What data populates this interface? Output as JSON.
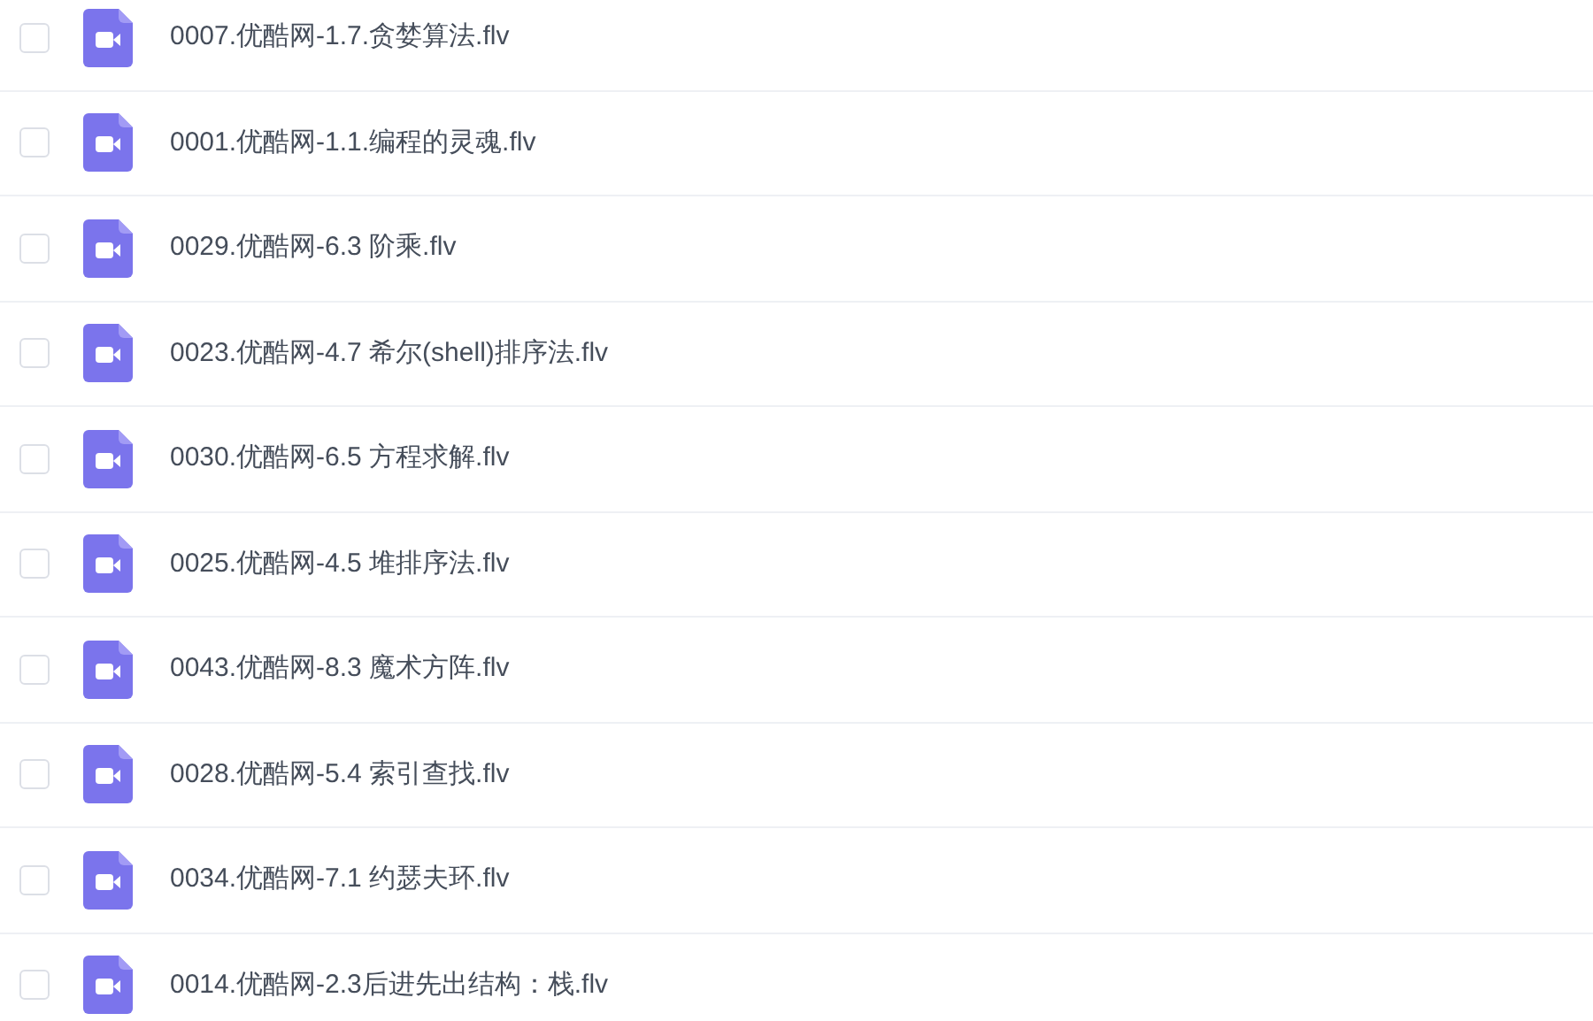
{
  "files": [
    {
      "name": "0007.优酷网-1.7.贪婪算法.flv",
      "checked": false
    },
    {
      "name": "0001.优酷网-1.1.编程的灵魂.flv",
      "checked": false
    },
    {
      "name": "0029.优酷网-6.3 阶乘.flv",
      "checked": false
    },
    {
      "name": "0023.优酷网-4.7 希尔(shell)排序法.flv",
      "checked": false
    },
    {
      "name": "0030.优酷网-6.5 方程求解.flv",
      "checked": false
    },
    {
      "name": "0025.优酷网-4.5 堆排序法.flv",
      "checked": false
    },
    {
      "name": "0043.优酷网-8.3 魔术方阵.flv",
      "checked": false
    },
    {
      "name": "0028.优酷网-5.4 索引查找.flv",
      "checked": false
    },
    {
      "name": "0034.优酷网-7.1 约瑟夫环.flv",
      "checked": false
    },
    {
      "name": "0014.优酷网-2.3后进先出结构：栈.flv",
      "checked": false
    }
  ]
}
